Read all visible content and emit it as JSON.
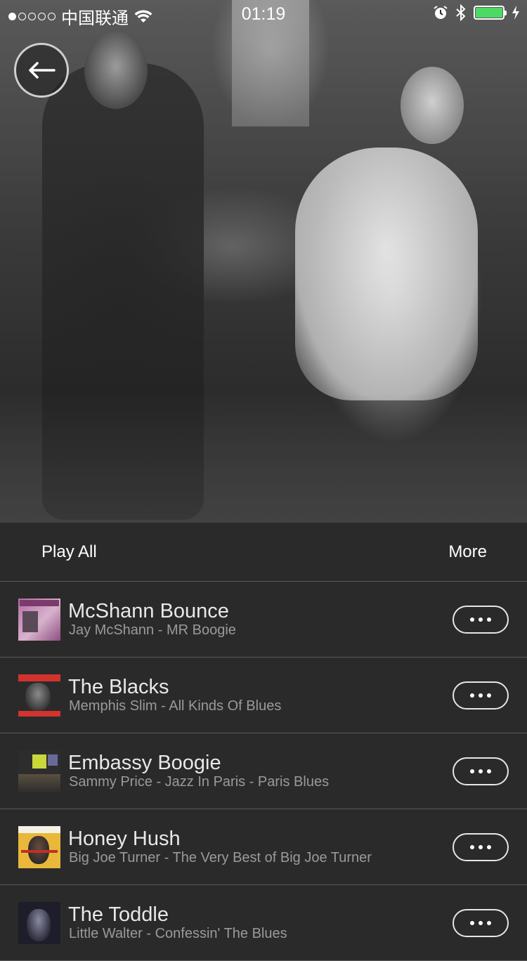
{
  "status_bar": {
    "carrier": "中国联通",
    "time": "01:19",
    "signal_dots_filled": 1,
    "signal_dots_total": 5,
    "battery_level": 1.0,
    "icons": [
      "wifi-icon",
      "alarm-icon",
      "bluetooth-icon",
      "battery-icon",
      "charging-icon"
    ]
  },
  "header": {
    "back_icon": "back-arrow-icon",
    "hero_image": "black-and-white swing dance photo"
  },
  "actions": {
    "play_all": "Play All",
    "more": "More"
  },
  "tracks": [
    {
      "title": "McShann Bounce",
      "subtitle": "Jay McShann - MR Boogie",
      "cover": [
        "#b46aa6",
        "#d8b2cd"
      ]
    },
    {
      "title": "The Blacks",
      "subtitle": "Memphis Slim - All Kinds Of Blues",
      "cover": [
        "#d2332d",
        "#2a2a2a"
      ]
    },
    {
      "title": "Embassy Boogie",
      "subtitle": "Sammy Price - Jazz In Paris - Paris Blues",
      "cover": [
        "#2d2d2d",
        "#c8d83a"
      ]
    },
    {
      "title": "Honey Hush",
      "subtitle": "Big Joe Turner - The Very Best of Big Joe Turner",
      "cover": [
        "#e9b83a",
        "#2a2a2a"
      ]
    },
    {
      "title": "The Toddle",
      "subtitle": "Little Walter - Confessin' The Blues",
      "cover": [
        "#1e1e2a",
        "#4a4a6a"
      ]
    }
  ],
  "colors": {
    "background": "#2a2a2a",
    "divider": "#5a5a5a",
    "battery": "#4cd964",
    "subtitle": "#9a9a9a"
  }
}
